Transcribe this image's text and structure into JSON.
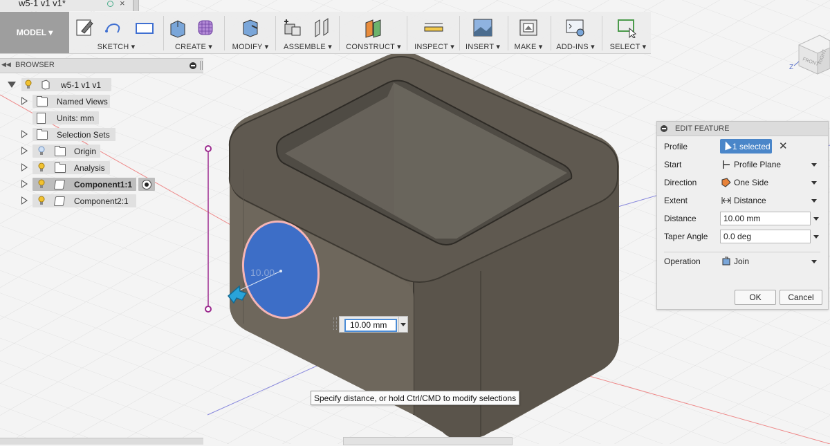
{
  "document_tab": {
    "title": "w5-1 v1 v1*",
    "close_label": "×"
  },
  "toolbar": {
    "model_button": "MODEL ▾",
    "groups": [
      "SKETCH ▾",
      "CREATE ▾",
      "MODIFY ▾",
      "ASSEMBLE ▾",
      "CONSTRUCT ▾",
      "INSPECT ▾",
      "INSERT ▾",
      "MAKE ▾",
      "ADD-INS ▾",
      "SELECT ▾"
    ]
  },
  "browser": {
    "title": "BROWSER",
    "collapse_arrows": "◀◀",
    "items": [
      {
        "label": "w5-1 v1 v1",
        "expanded": true
      },
      {
        "label": "Named Views"
      },
      {
        "label": "Units: mm"
      },
      {
        "label": "Selection Sets"
      },
      {
        "label": "Origin"
      },
      {
        "label": "Analysis"
      },
      {
        "label": "Component1:1",
        "active": true
      },
      {
        "label": "Component2:1"
      }
    ]
  },
  "edit_feature": {
    "title": "EDIT FEATURE",
    "rows": {
      "profile": {
        "label": "Profile",
        "value": "1 selected"
      },
      "start": {
        "label": "Start",
        "value": "Profile Plane"
      },
      "direction": {
        "label": "Direction",
        "value": "One Side"
      },
      "extent": {
        "label": "Extent",
        "value": "Distance"
      },
      "distance": {
        "label": "Distance",
        "value": "10.00 mm"
      },
      "taper_angle": {
        "label": "Taper Angle",
        "value": "0.0 deg"
      },
      "operation": {
        "label": "Operation",
        "value": "Join"
      }
    },
    "ok_label": "OK",
    "cancel_label": "Cancel"
  },
  "viewport": {
    "dimension_input": "10.00 mm",
    "circle_dimension": "10.00",
    "tooltip": "Specify distance, or hold Ctrl/CMD to modify selections",
    "viewcube_faces": [
      "FRONT",
      "RIGHT"
    ],
    "axis_label": "Z"
  },
  "colors": {
    "accent_blue": "#4a86c9",
    "profile_blue": "#3d6ec7",
    "body_gray": "#6b6459",
    "background": "#f4f4f4"
  }
}
